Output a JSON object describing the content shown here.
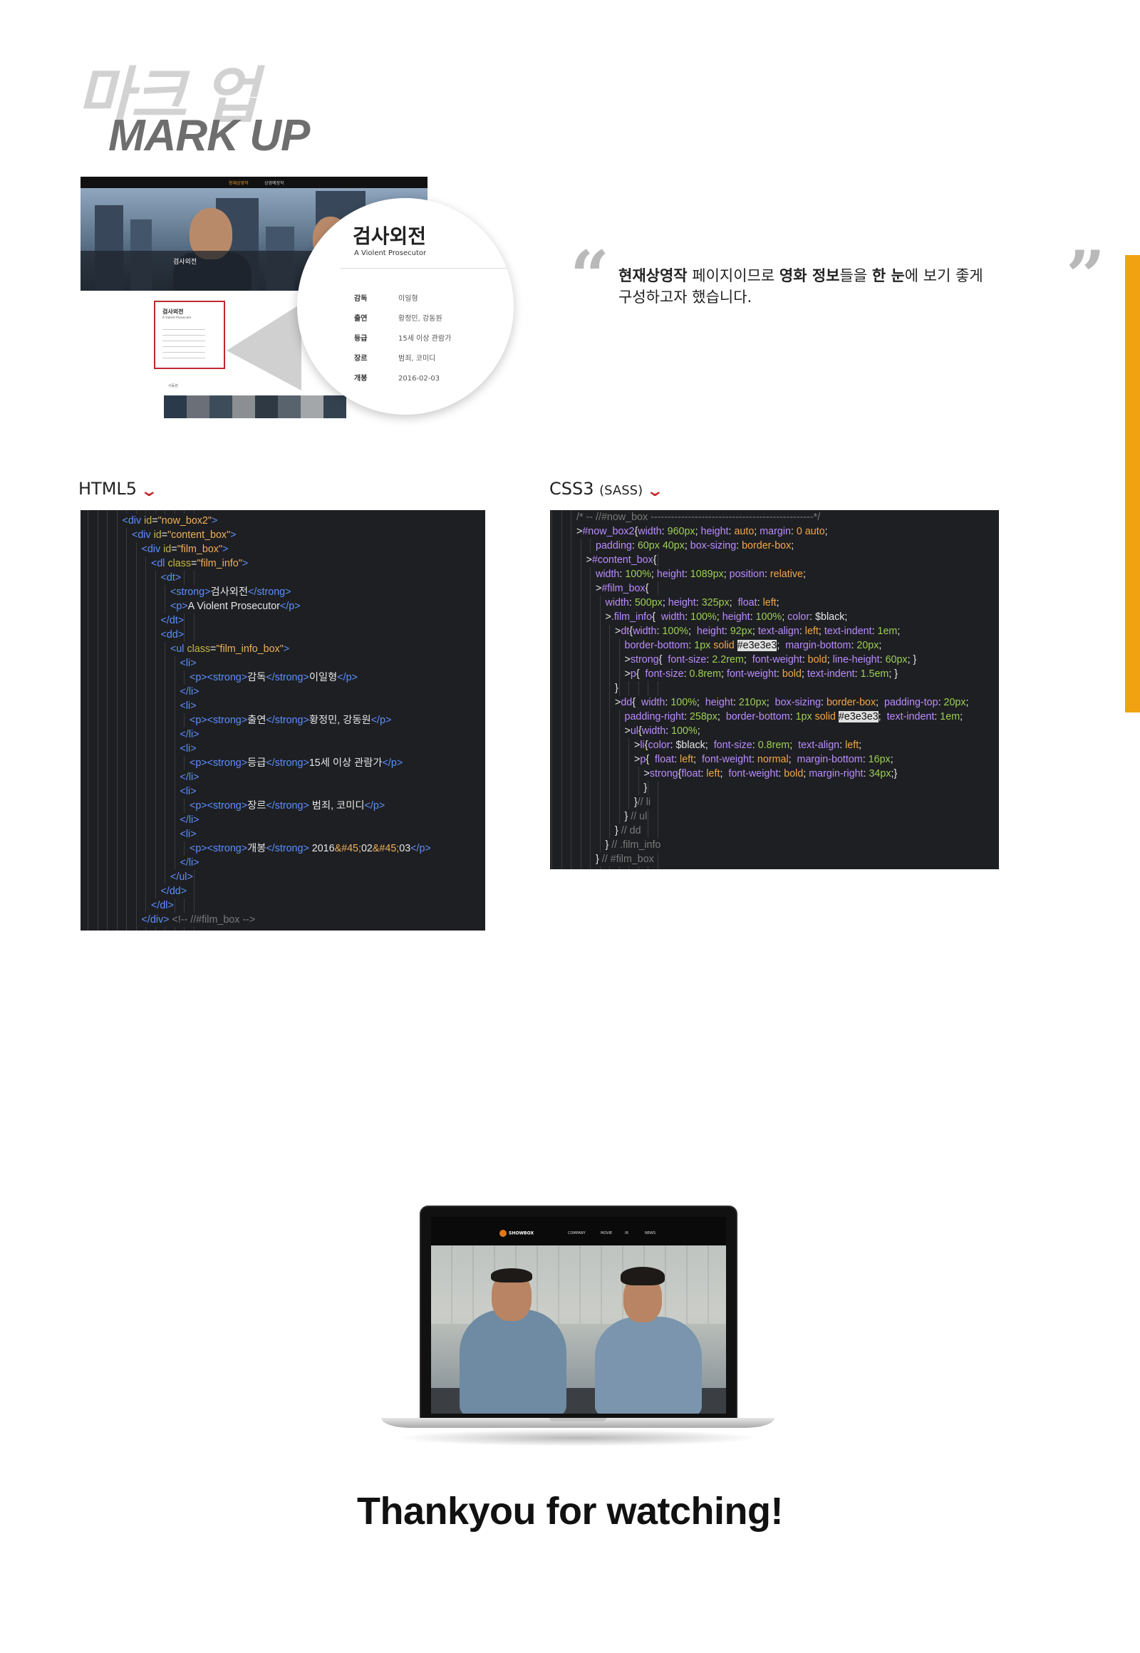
{
  "heading": {
    "korean": "마크 업",
    "english": "MARK UP"
  },
  "mockup": {
    "nav": [
      "현재상영작",
      "상영예정작"
    ],
    "hero_title": "검사외전",
    "box_title": "검사외전",
    "box_subtitle": "A Violent Prosecutor",
    "thumbs_label": "사동현",
    "magnifier": {
      "title": "검사외전",
      "subtitle": "A Violent Prosecutor",
      "rows": [
        {
          "label": "감독",
          "value": "이일형"
        },
        {
          "label": "출연",
          "value": "황정민, 강동원"
        },
        {
          "label": "등급",
          "value": "15세 이상 관람가"
        },
        {
          "label": "장르",
          "value": "범죄, 코미디"
        },
        {
          "label": "개봉",
          "value": "2016-02-03"
        }
      ]
    }
  },
  "quote": {
    "open": "“",
    "close": "”",
    "part1": "현재상영작",
    "part2": " 페이지이므로 ",
    "part3": "영화 정보",
    "part4": "들을 ",
    "part5": "한 눈",
    "part6": "에 보기 좋게",
    "line2": "구성하고자 했습니다."
  },
  "colors": {
    "accent": "#f0a211",
    "chevron": "#c0272d",
    "code_bg": "#1e1f22"
  },
  "html_panel": {
    "label": "HTML5"
  },
  "css_panel": {
    "label_main": "CSS3 ",
    "label_small": "(SASS)"
  },
  "laptop": {
    "logo": "SHOWBOX",
    "menu": [
      "COMPANY",
      "MOVIE",
      "IR",
      "NEWS"
    ]
  },
  "closing": "Thankyou for watching!"
}
